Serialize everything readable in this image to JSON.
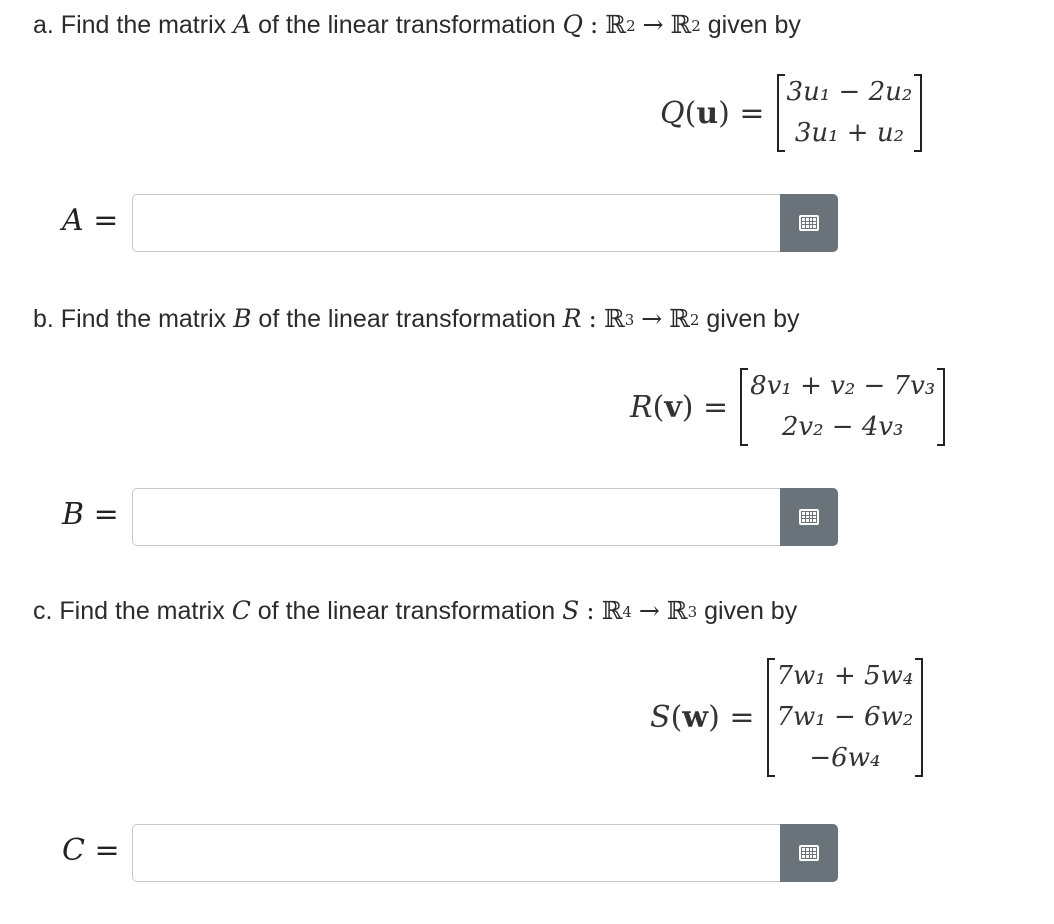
{
  "parts": [
    {
      "prefix": "a. Find the matrix",
      "letter": "A",
      "middle": "of the linear transformation",
      "map": "Q",
      "domain_dim": "2",
      "codomain_dim": "2",
      "suffix": "given by",
      "lhs_func": "Q",
      "lhs_arg": "u",
      "rows": [
        "3u₁ − 2u₂",
        "3u₁ + u₂"
      ],
      "answer_label": "A",
      "answer_value": ""
    },
    {
      "prefix": "b. Find the matrix",
      "letter": "B",
      "middle": "of the linear transformation",
      "map": "R",
      "domain_dim": "3",
      "codomain_dim": "2",
      "suffix": "given by",
      "lhs_func": "R",
      "lhs_arg": "v",
      "rows": [
        "8v₁ + v₂ − 7v₃",
        "2v₂ − 4v₃"
      ],
      "answer_label": "B",
      "answer_value": ""
    },
    {
      "prefix": "c. Find the matrix",
      "letter": "C",
      "middle": "of the linear transformation",
      "map": "S",
      "domain_dim": "4",
      "codomain_dim": "3",
      "suffix": "given by",
      "lhs_func": "S",
      "lhs_arg": "w",
      "rows": [
        "7w₁ + 5w₄",
        "7w₁ − 6w₂",
        "−6w₄"
      ],
      "answer_label": "C",
      "answer_value": ""
    }
  ],
  "symbols": {
    "colon": ":",
    "reals": "ℝ",
    "arrow": "→",
    "equals": "=",
    "open_paren": "(",
    "close_paren": ")"
  },
  "icons": {
    "matrix_button": "matrix-grid-icon"
  },
  "colors": {
    "button_bg": "#6b737a",
    "input_border": "#c8c8c8",
    "text": "#2b2b2b"
  }
}
